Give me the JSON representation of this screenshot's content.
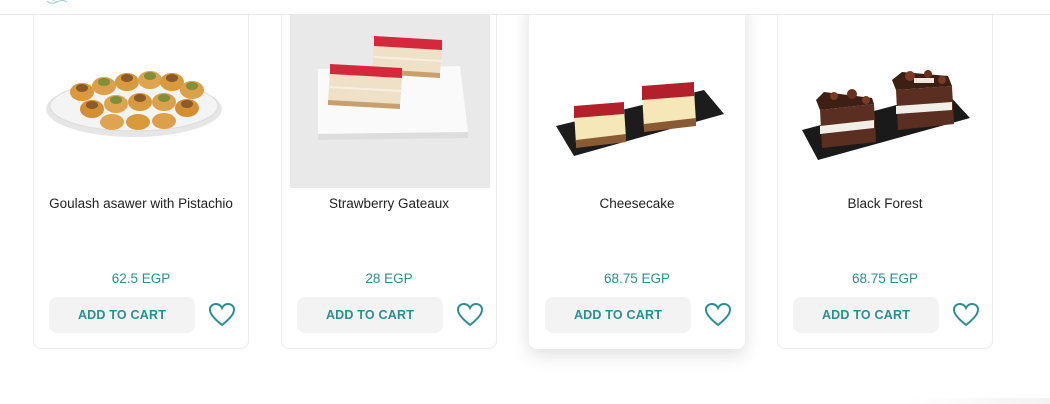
{
  "products": [
    {
      "name": "Goulash asawer with Pistachio",
      "price": "62.5 EGP",
      "cart_label": "ADD TO CART",
      "image_icon": "goulash-tray-image",
      "wishlist_icon": "heart-outline-icon"
    },
    {
      "name": "Strawberry Gateaux",
      "price": "28 EGP",
      "cart_label": "ADD TO CART",
      "image_icon": "strawberry-gateaux-image",
      "wishlist_icon": "heart-outline-icon"
    },
    {
      "name": "Cheesecake",
      "price": "68.75 EGP",
      "cart_label": "ADD TO CART",
      "image_icon": "cheesecake-image",
      "wishlist_icon": "heart-outline-icon"
    },
    {
      "name": "Black Forest",
      "price": "68.75 EGP",
      "cart_label": "ADD TO CART",
      "image_icon": "black-forest-image",
      "wishlist_icon": "heart-outline-icon"
    }
  ],
  "colors": {
    "accent": "#2a8f92",
    "button_bg": "#f3f3f3",
    "text": "#222222"
  }
}
